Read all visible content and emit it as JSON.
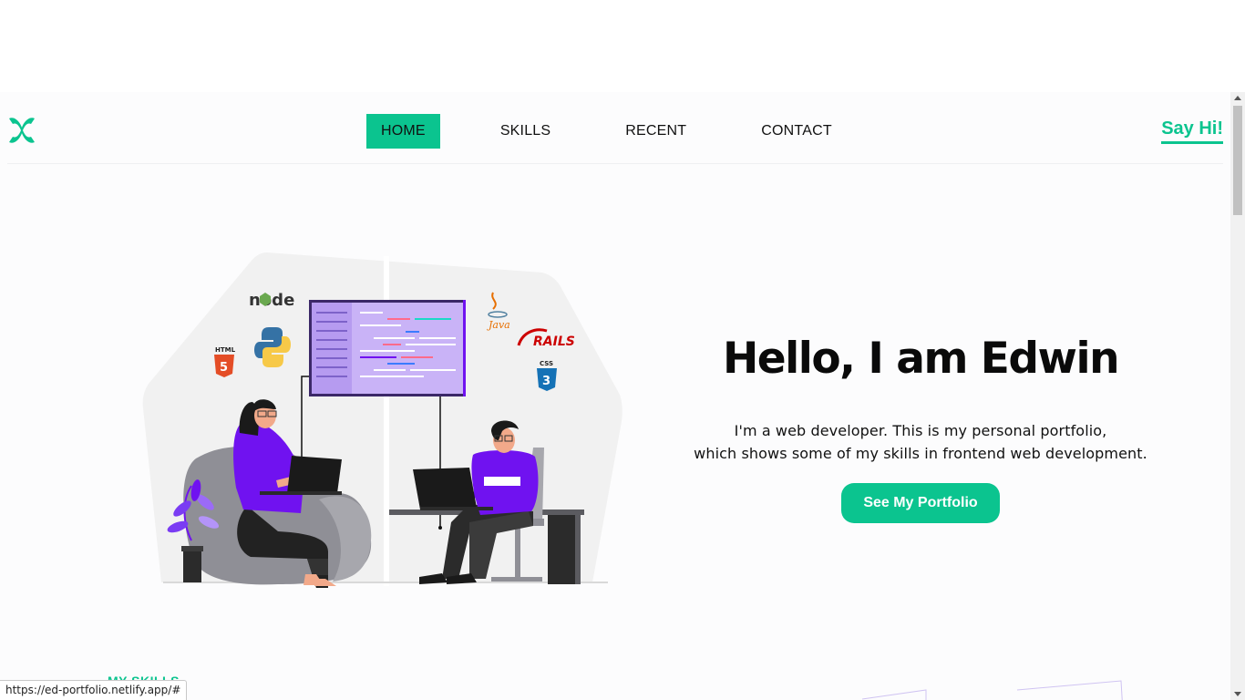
{
  "nav": {
    "links": [
      {
        "label": "HOME",
        "active": true
      },
      {
        "label": "SKILLS",
        "active": false
      },
      {
        "label": "RECENT",
        "active": false
      },
      {
        "label": "CONTACT",
        "active": false
      }
    ],
    "say_hi": "Say Hi!"
  },
  "hero": {
    "title": "Hello, I am Edwin",
    "desc_line1": "I'm a web developer. This is my personal portfolio,",
    "desc_line2": "which shows some of my skills in frontend web development.",
    "cta_label": "See My Portfolio",
    "illustration_logos": {
      "node": "node",
      "java": "Java",
      "rails": "RAILS",
      "html": "HTML",
      "css": "CSS"
    }
  },
  "sections": {
    "skills_label": "MY SKILLS"
  },
  "status_bar": {
    "url": "https://ed-portfolio.netlify.app/#"
  },
  "colors": {
    "accent": "#0bc48f",
    "purple": "#7012f0",
    "text": "#0a0a0a"
  }
}
